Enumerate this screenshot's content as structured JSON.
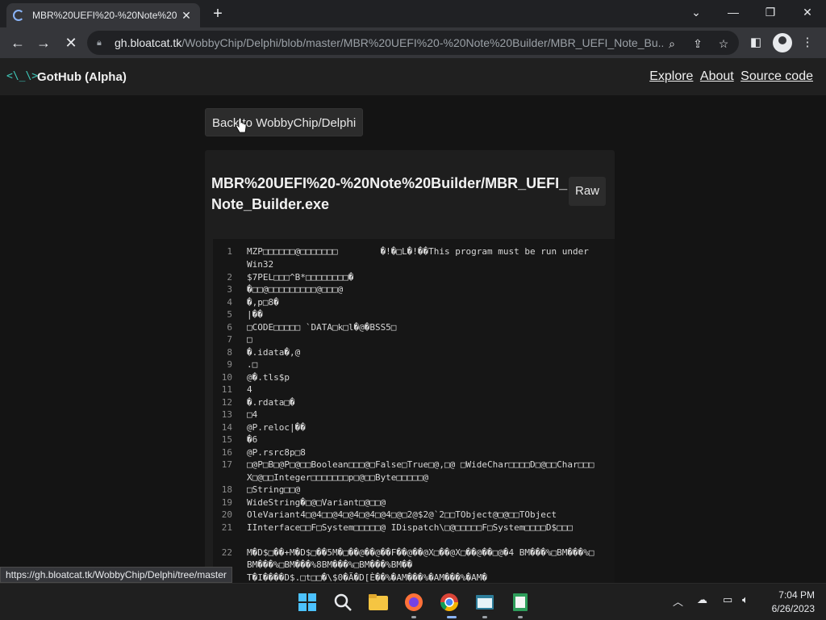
{
  "browser": {
    "tab_title": "MBR%20UEFI%20-%20Note%20",
    "url_host": "gh.bloatcat.tk",
    "url_path": "/WobbyChip/Delphi/blob/master/MBR%20UEFI%20-%20Note%20Builder/MBR_UEFI_Note_Bu...",
    "status_url": "https://gh.bloatcat.tk/WobbyChip/Delphi/tree/master"
  },
  "site": {
    "logo": "<\\_\\>",
    "brand": "GotHub (Alpha)",
    "nav": [
      "Explore",
      "About",
      "Source code"
    ]
  },
  "page": {
    "back_label": "Back to WobbyChip/Delphi",
    "file_title": "MBR%20UEFI%20-%20Note%20Builder/MBR_UEFI_Note_Builder.exe",
    "raw_label": "Raw"
  },
  "code_lines": [
    {
      "n": "1",
      "t": "MZP□□□□□□@□□□□□□□        �!�□L�!��This program must be run under Win32"
    },
    {
      "n": "2",
      "t": "$7PEL□□□^B*□□□□□□□□�"
    },
    {
      "n": "3",
      "t": "�□□@□□□□□□□□□@□□□@"
    },
    {
      "n": "4",
      "t": "�,p□8�"
    },
    {
      "n": "5",
      "t": "|��"
    },
    {
      "n": "6",
      "t": "□CODE□□□□□ `DATA□k□l�@�BSS5□"
    },
    {
      "n": "7",
      "t": "□"
    },
    {
      "n": "8",
      "t": "�.idata�,@"
    },
    {
      "n": "9",
      "t": ".□"
    },
    {
      "n": "10",
      "t": "@�.tls$p"
    },
    {
      "n": "11",
      "t": "4"
    },
    {
      "n": "12",
      "t": "�.rdata□�"
    },
    {
      "n": "13",
      "t": "□4"
    },
    {
      "n": "14",
      "t": "@P.reloc|��"
    },
    {
      "n": "15",
      "t": "�6"
    },
    {
      "n": "16",
      "t": "@P.rsrc8p□8"
    },
    {
      "n": "17",
      "t": "□@P□B□@P□@□□Boolean□□□@□False□True□@,□@ □WideChar□□□□D□@□□Char□□□X□@□□Integer□□□□□□□p□@□□Byte□□□□□@"
    },
    {
      "n": "18",
      "t": "□String□□@"
    },
    {
      "n": "19",
      "t": "WideString�□@□Variant□@□□@"
    },
    {
      "n": "20",
      "t": "OleVariant4□@4□□@4□@4□@4□@4□@□2@$2@`2□□TObject@□@□□TObject"
    },
    {
      "n": "21",
      "t": "IInterface□□F□System□□□□□@ IDispatch\\□@□□□□□F□System□□□□D$□□□"
    },
    {
      "n": "22",
      "t": "M�D$□��+M�D$□��5M�□��@��@��F��@��@X□��@X□��@��□@�4 BM���%□BM���%□BM���%□BM���%8BM���%□BM���%BM��"
    },
    {
      "n": "23",
      "t": "T�I����D$.□t□□�\\$0�Ã�D[È��%�AM���%�AM���%�AM�"
    }
  ],
  "taskbar": {
    "time": "7:04 PM",
    "date": "6/26/2023"
  }
}
